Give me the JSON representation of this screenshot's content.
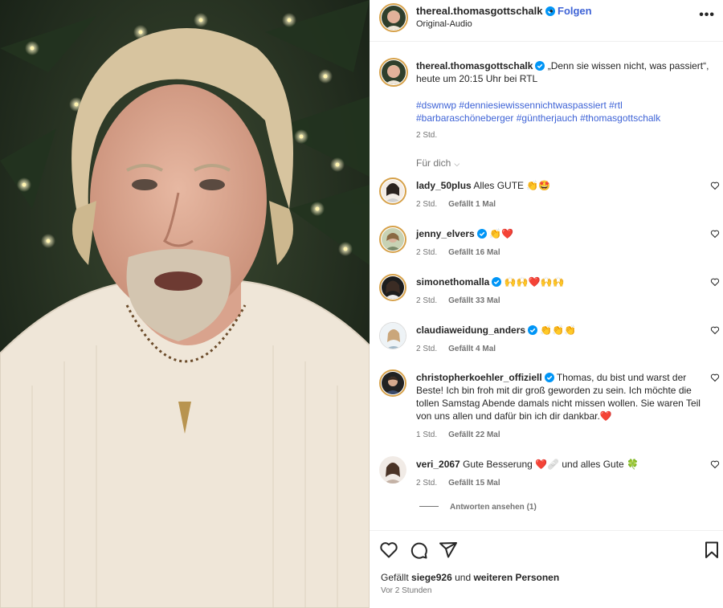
{
  "post": {
    "username": "thereal.thomasgottschalk",
    "follow_label": "Folgen",
    "dot": "•",
    "audio": "Original-Audio",
    "more": "•••"
  },
  "caption": {
    "username": "thereal.thomasgottschalk",
    "text": "„Denn sie wissen nicht, was passiert“, heute um 20:15 Uhr bei RTL",
    "tags_line1": "#dswnwp #denniesiewissennichtwaspassiert #rtl",
    "tags_line2": "#barbaraschöneberger #güntherjauch #thomasgottschalk",
    "time": "2 Std."
  },
  "filter": {
    "label": "Für dich",
    "chevron": "⌵"
  },
  "comments": [
    {
      "username": "lady_50plus",
      "verified": false,
      "text": "Alles GUTE 👏🤩",
      "time": "2 Std.",
      "likes": "Gefällt 1 Mal"
    },
    {
      "username": "jenny_elvers",
      "verified": true,
      "text": "👏❤️",
      "time": "2 Std.",
      "likes": "Gefällt 16 Mal"
    },
    {
      "username": "simonethomalla",
      "verified": true,
      "text": "🙌🙌❤️🙌🙌",
      "time": "2 Std.",
      "likes": "Gefällt 33 Mal"
    },
    {
      "username": "claudiaweidung_anders",
      "verified": true,
      "text": "👏👏👏",
      "time": "2 Std.",
      "likes": "Gefällt 4 Mal"
    },
    {
      "username": "christopherkoehler_offiziell",
      "verified": true,
      "text": "Thomas, du bist und warst der Beste! Ich bin froh mit dir groß geworden zu sein. Ich möchte die tollen Samstag Abende damals nicht missen wollen. Sie waren Teil von uns allen und dafür bin ich dir dankbar.❤️",
      "time": "1 Std.",
      "likes": "Gefällt 22 Mal"
    },
    {
      "username": "veri_2067",
      "verified": false,
      "text": "Gute Besserung ❤️🩹 und alles Gute 🍀",
      "time": "2 Std.",
      "likes": "Gefällt 15 Mal"
    }
  ],
  "replies": {
    "label": "Antworten ansehen (1)"
  },
  "footer": {
    "liked_prefix": "Gefällt",
    "liked_user": "siege926",
    "liked_and": "und",
    "liked_others": "weiteren Personen",
    "ago": "Vor 2 Stunden"
  },
  "icons": {
    "verified": "verified-badge-icon",
    "like": "heart-icon",
    "comment": "comment-icon",
    "share": "share-icon",
    "save": "bookmark-icon"
  },
  "colors": {
    "link": "#3e63d6",
    "verified": "#0095f6",
    "muted": "#737373",
    "text": "#262626"
  }
}
